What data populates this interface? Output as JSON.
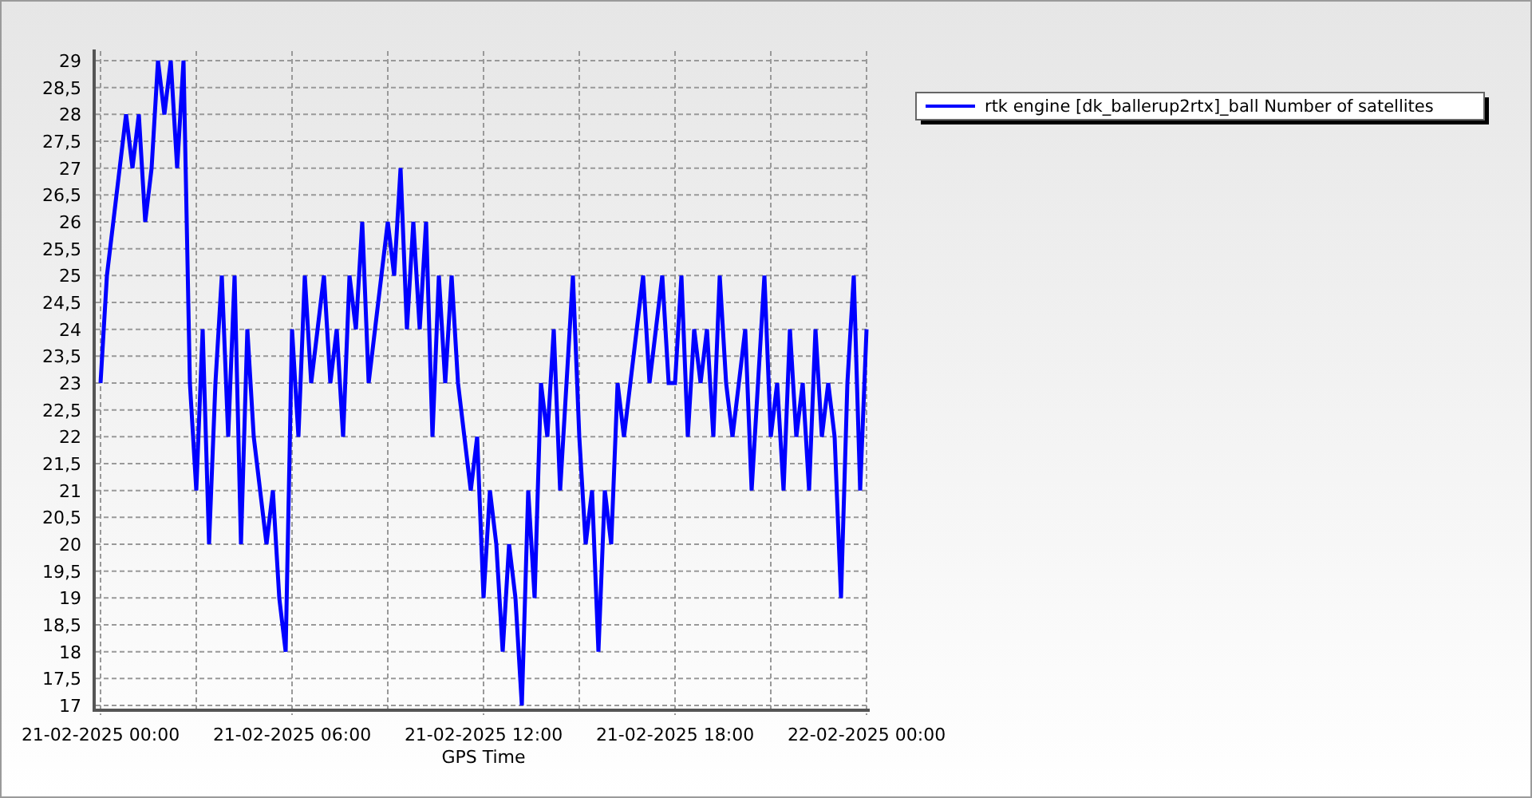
{
  "chart": {
    "chart_data": {
      "type": "line",
      "xlabel": "GPS Time",
      "grid": true,
      "categories": [
        "21-02-2025 00:00",
        null,
        null,
        null,
        null,
        null,
        null,
        null,
        null,
        null,
        null,
        null,
        null,
        null,
        null,
        null,
        null,
        null,
        null,
        null,
        null,
        null,
        null,
        null,
        null,
        null,
        null,
        null,
        null,
        null,
        "21-02-2025 06:00",
        null,
        null,
        null,
        null,
        null,
        null,
        null,
        null,
        null,
        null,
        null,
        null,
        null,
        null,
        null,
        null,
        null,
        null,
        null,
        null,
        null,
        null,
        null,
        null,
        null,
        null,
        null,
        null,
        null,
        "21-02-2025 12:00",
        null,
        null,
        null,
        null,
        null,
        null,
        null,
        null,
        null,
        null,
        null,
        null,
        null,
        null,
        null,
        null,
        null,
        null,
        null,
        null,
        null,
        null,
        null,
        null,
        null,
        null,
        null,
        null,
        null,
        "21-02-2025 18:00",
        null,
        null,
        null,
        null,
        null,
        null,
        null,
        null,
        null,
        null,
        null,
        null,
        null,
        null,
        null,
        null,
        null,
        null,
        null,
        null,
        null,
        null,
        null,
        null,
        null,
        null,
        null,
        null,
        null,
        "22-02-2025 00:00"
      ],
      "series": [
        {
          "name": "rtk engine [dk_ballerup2rtx]_ball Number of satellites",
          "color": "#0000ff",
          "values": [
            23,
            25,
            26,
            27,
            28,
            27,
            28,
            26,
            27,
            29,
            28,
            29,
            27,
            29,
            23,
            21,
            24,
            20,
            23,
            25,
            22,
            25,
            20,
            24,
            22,
            21,
            20,
            21,
            19,
            18,
            24,
            22,
            25,
            23,
            24,
            25,
            23,
            24,
            22,
            25,
            24,
            26,
            23,
            24,
            25,
            26,
            25,
            27,
            24,
            26,
            24,
            26,
            22,
            25,
            23,
            25,
            23,
            22,
            21,
            22,
            19,
            21,
            20,
            18,
            20,
            19,
            17,
            21,
            19,
            23,
            22,
            24,
            21,
            23,
            25,
            22,
            20,
            21,
            18,
            21,
            20,
            23,
            22,
            23,
            24,
            25,
            23,
            24,
            25,
            23,
            23,
            25,
            22,
            24,
            23,
            24,
            22,
            25,
            23,
            22,
            23,
            24,
            21,
            23,
            25,
            22,
            23,
            21,
            24,
            22,
            23,
            21,
            24,
            22,
            23,
            22,
            19,
            23,
            25,
            21,
            24
          ]
        }
      ],
      "ylim": [
        17,
        29
      ],
      "yticks": [
        17,
        {
          "value": 17.5,
          "label": "17,5"
        },
        18,
        {
          "value": 18.5,
          "label": "18,5"
        },
        19,
        {
          "value": 19.5,
          "label": "19,5"
        },
        20,
        {
          "value": 20.5,
          "label": "20,5"
        },
        21,
        {
          "value": 21.5,
          "label": "21,5"
        },
        22,
        {
          "value": 22.5,
          "label": "22,5"
        },
        23,
        {
          "value": 23.5,
          "label": "23,5"
        },
        24,
        {
          "value": 24.5,
          "label": "24,5"
        },
        25,
        {
          "value": 25.5,
          "label": "25,5"
        },
        26,
        {
          "value": 26.5,
          "label": "26,5"
        },
        27,
        {
          "value": 27.5,
          "label": "27,5"
        },
        28,
        {
          "value": 28.5,
          "label": "28,5"
        },
        29
      ]
    }
  }
}
